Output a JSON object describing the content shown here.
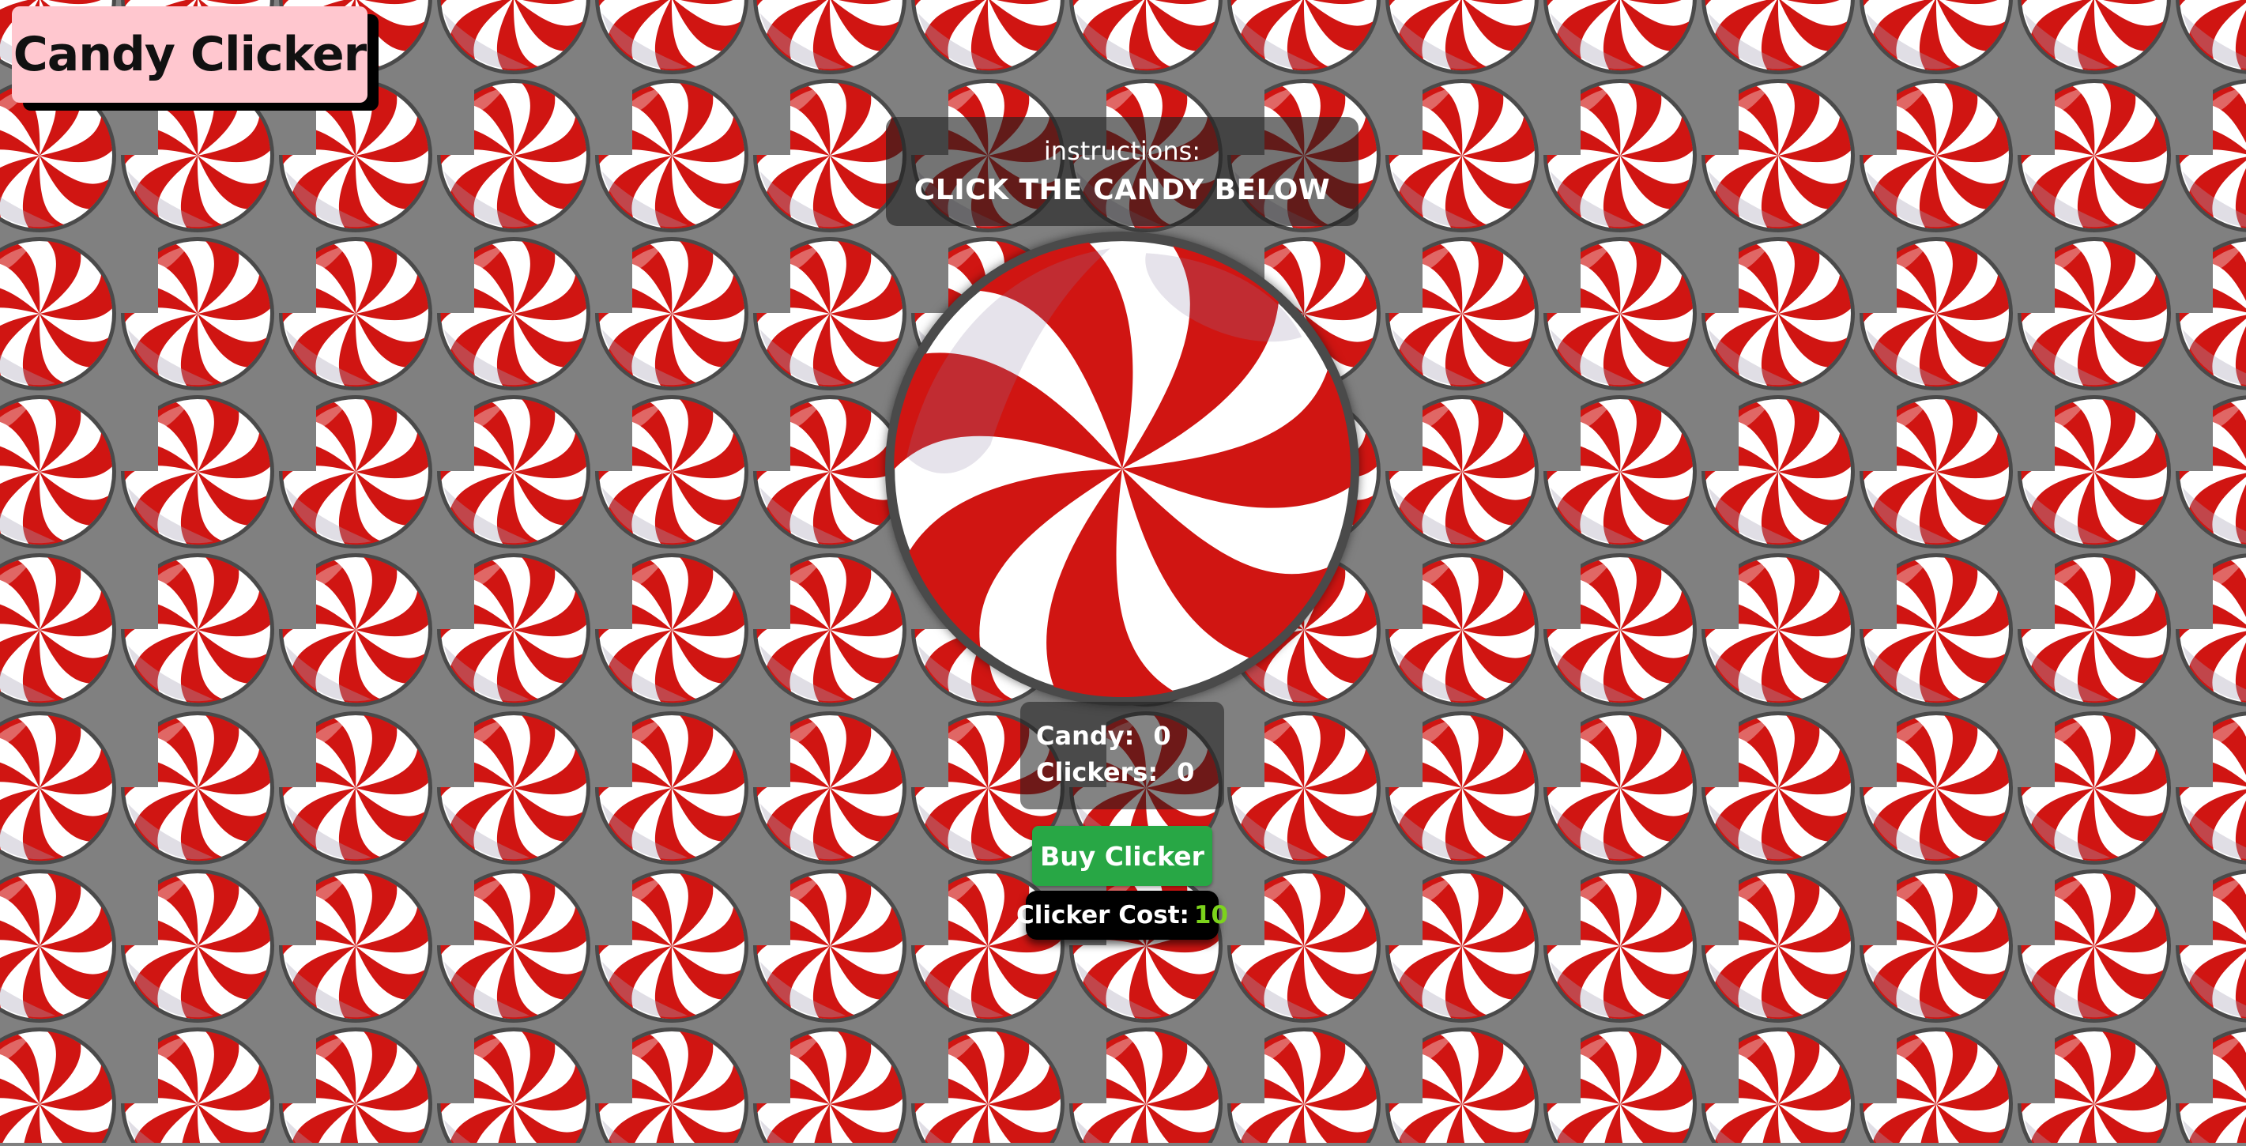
{
  "game": {
    "title": "Candy Clicker",
    "background_color": "#808080",
    "candy_colors": {
      "red": "#d01512",
      "white": "#ffffff",
      "shade": "#dcd3e3",
      "outline": "#4a4a4a"
    }
  },
  "instructions": {
    "label": "instructions:",
    "text": "CLICK THE CANDY BELOW"
  },
  "stats": {
    "candy_label": "Candy:",
    "candy_value": "0",
    "clickers_label": "Clickers:",
    "clickers_value": "0"
  },
  "shop": {
    "buy_label": "Buy Clicker",
    "cost_label": "Clicker Cost:",
    "cost_value": "10",
    "button_color": "#28a745",
    "cost_value_color": "#7cd31c"
  },
  "icons": {
    "background": "peppermint-candy-icon",
    "main": "peppermint-candy-icon"
  }
}
